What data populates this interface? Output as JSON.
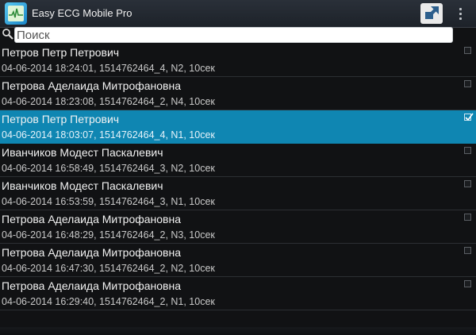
{
  "app": {
    "title": "Easy ECG Mobile Pro",
    "accent": "#0f86b2"
  },
  "search": {
    "placeholder": "Поиск",
    "value": ""
  },
  "records": [
    {
      "name": "Петров Петр Петрович",
      "meta": "04-06-2014 18:24:01, 1514762464_4, N2,  10сек",
      "selected": false
    },
    {
      "name": "Петрова Аделаида Митрофановна",
      "meta": "04-06-2014 18:23:08, 1514762464_2, N4,  10сек",
      "selected": false
    },
    {
      "name": "Петров Петр Петрович",
      "meta": "04-06-2014 18:03:07, 1514762464_4, N1,  10сек",
      "selected": true
    },
    {
      "name": "Иванчиков Модест Паскалевич",
      "meta": "04-06-2014 16:58:49, 1514762464_3, N2,  10сек",
      "selected": false
    },
    {
      "name": "Иванчиков Модест Паскалевич",
      "meta": "04-06-2014 16:53:59, 1514762464_3, N1,  10сек",
      "selected": false
    },
    {
      "name": "Петрова Аделаида Митрофановна",
      "meta": "04-06-2014 16:48:29, 1514762464_2, N3,  10сек",
      "selected": false
    },
    {
      "name": "Петрова Аделаида Митрофановна",
      "meta": "04-06-2014 16:47:30, 1514762464_2, N2,  10сек",
      "selected": false
    },
    {
      "name": "Петрова Аделаида Митрофановна",
      "meta": "04-06-2014 16:29:40, 1514762464_2, N1,  10сек",
      "selected": false
    }
  ],
  "icons": {
    "app": "ecg-app-icon",
    "expand": "expand-icon",
    "overflow": "overflow-menu-icon",
    "search": "search-icon",
    "check": "checkmark-icon"
  }
}
